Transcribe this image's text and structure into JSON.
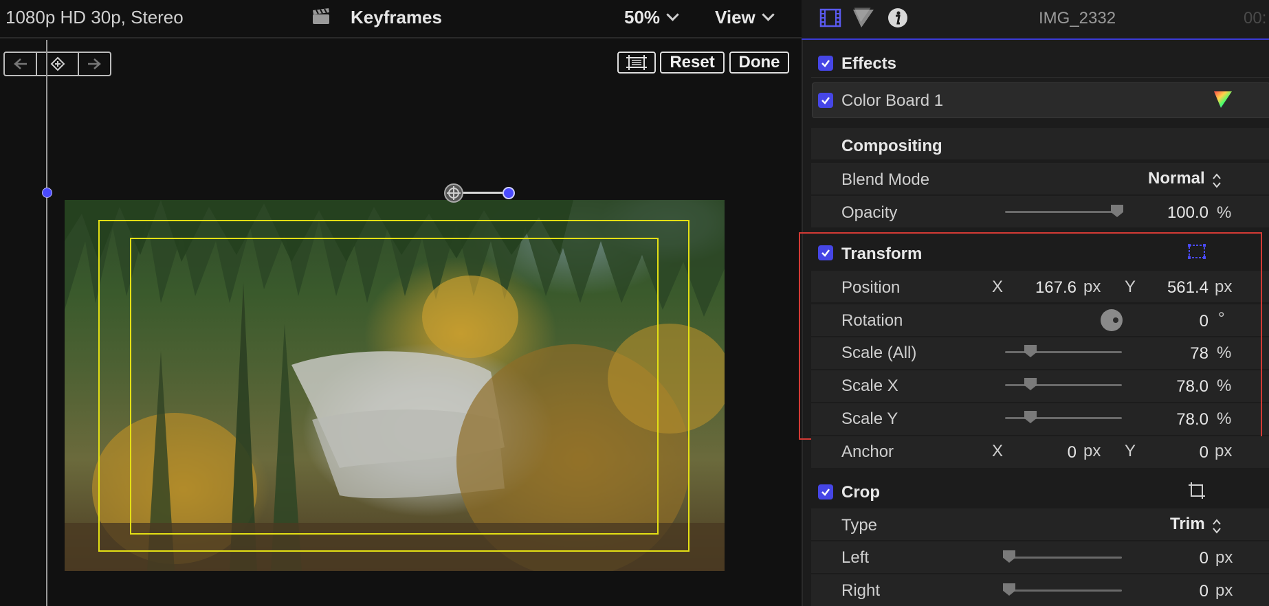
{
  "viewer": {
    "format_label": "1080p HD 30p, Stereo",
    "title": "Keyframes",
    "zoom": "50%",
    "view_label": "View",
    "reset_label": "Reset",
    "done_label": "Done"
  },
  "inspector": {
    "clip_name": "IMG_2332",
    "timecode": "00:",
    "effects": {
      "label": "Effects",
      "items": [
        {
          "label": "Color Board 1"
        }
      ]
    },
    "compositing": {
      "label": "Compositing",
      "blend_mode_label": "Blend Mode",
      "blend_mode_value": "Normal",
      "opacity_label": "Opacity",
      "opacity_value": "100.0",
      "opacity_unit": "%",
      "opacity_level": 1.0
    },
    "transform": {
      "label": "Transform",
      "position_label": "Position",
      "x_label": "X",
      "y_label": "Y",
      "position_x": "167.6",
      "position_y": "561.4",
      "px": "px",
      "rotation_label": "Rotation",
      "rotation_value": "0",
      "rotation_unit": "°",
      "scale_all_label": "Scale (All)",
      "scale_all_value": "78",
      "scale_x_label": "Scale X",
      "scale_x_value": "78.0",
      "scale_y_label": "Scale Y",
      "scale_y_value": "78.0",
      "percent": "%",
      "anchor_label": "Anchor",
      "anchor_x": "0",
      "anchor_y": "0"
    },
    "crop": {
      "label": "Crop",
      "type_label": "Type",
      "type_value": "Trim",
      "left_label": "Left",
      "left_value": "0",
      "right_label": "Right",
      "right_value": "0",
      "px": "px"
    }
  },
  "colors": {
    "accent": "#4646e6",
    "highlight_box": "#d43a35",
    "safe_zone": "#e4e014"
  }
}
